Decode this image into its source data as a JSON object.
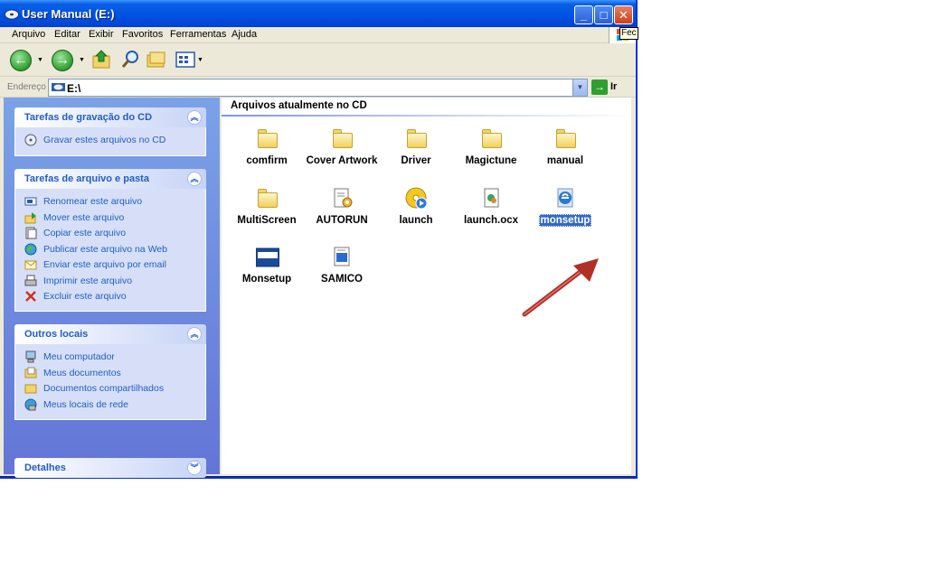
{
  "window": {
    "title": "User Manual (E:)",
    "tooltip_fragment": "Fec"
  },
  "menu": [
    "Arquivo",
    "Editar",
    "Exibir",
    "Favoritos",
    "Ferramentas",
    "Ajuda"
  ],
  "address": {
    "label": "Endereço",
    "value": "E:\\",
    "go_label": "Ir"
  },
  "taskpane": {
    "cd_tasks": {
      "title": "Tarefas de gravação do CD",
      "items": [
        {
          "label": "Gravar estes arquivos no CD",
          "icon": "burn-cd-icon"
        }
      ]
    },
    "file_tasks": {
      "title": "Tarefas de arquivo e pasta",
      "items": [
        {
          "label": "Renomear este arquivo",
          "icon": "rename-icon"
        },
        {
          "label": "Mover este arquivo",
          "icon": "move-icon"
        },
        {
          "label": "Copiar este arquivo",
          "icon": "copy-icon"
        },
        {
          "label": "Publicar este arquivo na Web",
          "icon": "web-publish-icon"
        },
        {
          "label": "Enviar este arquivo por email",
          "icon": "email-icon"
        },
        {
          "label": "Imprimir este arquivo",
          "icon": "print-icon"
        },
        {
          "label": "Excluir este arquivo",
          "icon": "delete-icon"
        }
      ]
    },
    "other_places": {
      "title": "Outros locais",
      "items": [
        {
          "label": "Meu computador",
          "icon": "my-computer-icon"
        },
        {
          "label": "Meus documentos",
          "icon": "my-documents-icon"
        },
        {
          "label": "Documentos compartilhados",
          "icon": "shared-documents-icon"
        },
        {
          "label": "Meus locais de rede",
          "icon": "network-places-icon"
        }
      ]
    },
    "details": {
      "title": "Detalhes"
    }
  },
  "content": {
    "header": "Arquivos atualmente no CD",
    "items": [
      {
        "label": "comfirm",
        "type": "folder"
      },
      {
        "label": "Cover Artwork",
        "type": "folder"
      },
      {
        "label": "Driver",
        "type": "folder"
      },
      {
        "label": "Magictune",
        "type": "folder"
      },
      {
        "label": "manual",
        "type": "folder"
      },
      {
        "label": "MultiScreen",
        "type": "folder"
      },
      {
        "label": "AUTORUN",
        "type": "autorun"
      },
      {
        "label": "launch",
        "type": "media"
      },
      {
        "label": "launch.ocx",
        "type": "ocx"
      },
      {
        "label": "monsetup",
        "type": "html",
        "selected": true
      },
      {
        "label": "Monsetup",
        "type": "bitmap"
      },
      {
        "label": "SAMICO",
        "type": "ini"
      }
    ]
  },
  "colors": {
    "titlebar": "#0054e3",
    "taskpane": "#6f8ee0",
    "link": "#215dc6",
    "selection": "#316ac5",
    "arrow": "#c0392b"
  }
}
